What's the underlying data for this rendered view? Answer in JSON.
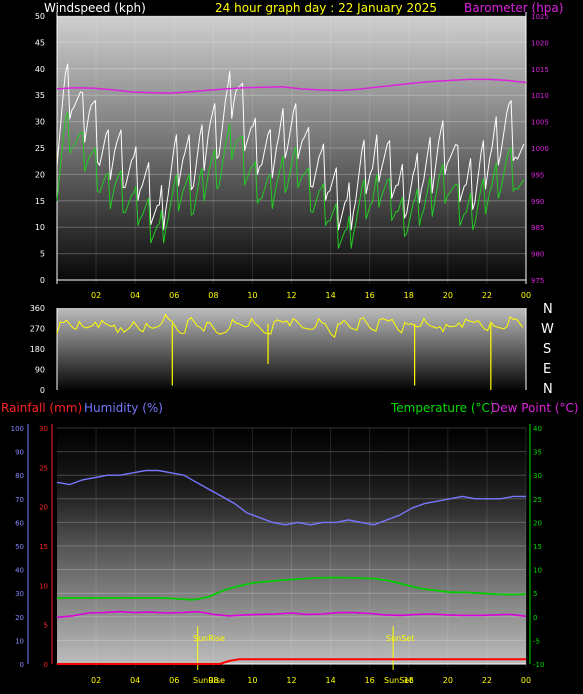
{
  "header": {
    "windspeed_label": "Windspeed (kph)",
    "title": "24 hour graph day : 22 January 2025",
    "barometer_label": "Barometer (hpa)"
  },
  "direction_labels": [
    "N",
    "W",
    "S",
    "E",
    "N"
  ],
  "bottom_header": {
    "rainfall_label": "Rainfall (mm)",
    "humidity_label": "Humidity (%)",
    "temperature_label": "Temperature (°C)",
    "dewpoint_label": "Dew Point (°C)"
  },
  "sun_labels": {
    "sunrise": "SunRise",
    "sunset": "SunSet",
    "sunrise_axis": "SunRise",
    "sunset_axis": "SunSet"
  },
  "colors": {
    "wind_gust": "#ffffff",
    "wind_avg": "#22cc22",
    "barometer": "#dd22dd",
    "direction": "#ffff00",
    "rainfall": "#ff0000",
    "humidity": "#7777ff",
    "temperature": "#00cc00",
    "dewpoint": "#dd00dd",
    "time_tick": "#ffff00"
  },
  "chart_data": [
    {
      "type": "line",
      "name": "wind-barometer",
      "x_ticks": [
        "02",
        "04",
        "06",
        "08",
        "10",
        "12",
        "14",
        "16",
        "18",
        "20",
        "22",
        "00"
      ],
      "y_left_ticks": [
        0,
        5,
        10,
        15,
        20,
        25,
        30,
        35,
        40,
        45,
        50
      ],
      "y_right_ticks": [
        975,
        980,
        985,
        990,
        995,
        1000,
        1005,
        1010,
        1015,
        1020,
        1025
      ],
      "ylim_left": [
        0,
        50
      ],
      "ylim_right": [
        975,
        1025
      ],
      "xlim_hours": [
        0,
        24
      ],
      "grid": true,
      "gust_kph": [
        27,
        37,
        35,
        30,
        32,
        25,
        24,
        26,
        22,
        20,
        19,
        16,
        12,
        18,
        22,
        23,
        21,
        25,
        30,
        28,
        33,
        37,
        30,
        27,
        24,
        23,
        26,
        28,
        29,
        27,
        22,
        21,
        18,
        15,
        13,
        17,
        21,
        20,
        24,
        22,
        18,
        17,
        18,
        20,
        22,
        26,
        25,
        20,
        17,
        18,
        22,
        25,
        28,
        30,
        24,
        19
      ],
      "avg_kph": [
        19,
        29,
        27,
        24,
        23,
        19,
        17,
        19,
        16,
        14,
        13,
        11,
        9,
        13,
        16,
        17,
        15,
        18,
        22,
        21,
        25,
        27,
        22,
        20,
        17,
        16,
        19,
        20,
        22,
        20,
        16,
        15,
        12,
        10,
        8,
        12,
        15,
        14,
        18,
        16,
        13,
        12,
        13,
        14,
        16,
        19,
        18,
        14,
        12,
        13,
        16,
        18,
        20,
        22,
        18,
        14
      ],
      "barometer_hpa": [
        1011.2,
        1011.4,
        1011.3,
        1011.0,
        1010.6,
        1010.5,
        1010.4,
        1010.6,
        1010.9,
        1011.2,
        1011.4,
        1011.5,
        1011.6,
        1011.2,
        1011.0,
        1010.9,
        1011.1,
        1011.5,
        1011.9,
        1012.3,
        1012.6,
        1012.8,
        1013.0,
        1013.0,
        1012.8,
        1012.4
      ]
    },
    {
      "type": "line",
      "name": "wind-direction",
      "y_ticks": [
        0,
        90,
        180,
        270,
        360
      ],
      "ylim": [
        0,
        360
      ],
      "xlim_hours": [
        0,
        24
      ],
      "direction_deg": [
        270,
        300,
        285,
        260,
        310,
        275,
        290,
        230,
        300,
        280,
        265,
        315,
        290,
        260,
        300,
        280,
        270,
        245,
        295,
        285,
        300,
        270,
        260,
        290,
        310,
        280,
        270,
        300,
        285,
        250,
        295,
        280,
        300,
        270,
        290,
        310,
        275,
        285,
        300,
        270,
        290,
        260,
        300,
        280,
        305,
        285,
        270,
        295,
        300,
        280
      ],
      "dips": [
        {
          "hour": 5.9,
          "deg": 20
        },
        {
          "hour": 10.8,
          "deg": 115
        },
        {
          "hour": 18.3,
          "deg": 20
        },
        {
          "hour": 22.2,
          "deg": 0
        }
      ]
    },
    {
      "type": "line",
      "name": "rain-humidity-temperature",
      "x_ticks": [
        "02",
        "04",
        "06",
        "08",
        "10",
        "12",
        "14",
        "16",
        "18",
        "20",
        "22",
        "00"
      ],
      "y_left_humidity_ticks": [
        0,
        10,
        20,
        30,
        40,
        50,
        60,
        70,
        80,
        90,
        100
      ],
      "y_left_rain_ticks": [
        0,
        5,
        10,
        15,
        20,
        25,
        30
      ],
      "y_right_temp_ticks": [
        -10,
        -5,
        0,
        5,
        10,
        15,
        20,
        25,
        30,
        35,
        40
      ],
      "ylim_humidity": [
        0,
        100
      ],
      "ylim_rain": [
        0,
        30
      ],
      "ylim_temp": [
        -10,
        40
      ],
      "xlim_hours": [
        0,
        24
      ],
      "grid": true,
      "humidity_pct": [
        77,
        76,
        78,
        79,
        80,
        80,
        81,
        82,
        82,
        81,
        80,
        77,
        74,
        71,
        68,
        64,
        62,
        60,
        59,
        60,
        59,
        60,
        60,
        61,
        60,
        59,
        61,
        63,
        66,
        68,
        69,
        70,
        71,
        70,
        70,
        70,
        71,
        71
      ],
      "temperature_c": [
        4.0,
        4.0,
        4.0,
        4.0,
        4.0,
        4.0,
        4.0,
        4.0,
        3.8,
        3.6,
        4.2,
        5.6,
        6.5,
        7.2,
        7.5,
        7.8,
        8.0,
        8.2,
        8.3,
        8.3,
        8.2,
        8.1,
        7.6,
        6.8,
        6.0,
        5.6,
        5.2,
        5.2,
        5.0,
        4.8,
        4.7,
        4.8
      ],
      "dewpoint_c": [
        -0.1,
        0.2,
        0.8,
        0.9,
        1.1,
        0.9,
        1.0,
        0.8,
        0.9,
        1.1,
        0.5,
        0.2,
        0.4,
        0.5,
        0.6,
        0.8,
        0.5,
        0.6,
        0.9,
        0.9,
        0.7,
        0.4,
        0.3,
        0.5,
        0.6,
        0.4,
        0.3,
        0.3,
        0.4,
        0.5,
        0.1
      ],
      "rainfall_mm": [
        0.0,
        0.0,
        0.0,
        0.0,
        0.0,
        0.0,
        0.0,
        0.0,
        0.0,
        0.0,
        0.0,
        0.0,
        0.0,
        0.0,
        0.0,
        0.0,
        0.0,
        0.0,
        0.4,
        0.6,
        0.6,
        0.6,
        0.6,
        0.6,
        0.6,
        0.6,
        0.6,
        0.6,
        0.6,
        0.6,
        0.6,
        0.6,
        0.6,
        0.6,
        0.6,
        0.6,
        0.6,
        0.6,
        0.6,
        0.6,
        0.6,
        0.6,
        0.6,
        0.6,
        0.6,
        0.6,
        0.6,
        0.6,
        0.6,
        0.6
      ],
      "sunrise_hour": 7.2,
      "sunset_hour": 17.2
    }
  ]
}
